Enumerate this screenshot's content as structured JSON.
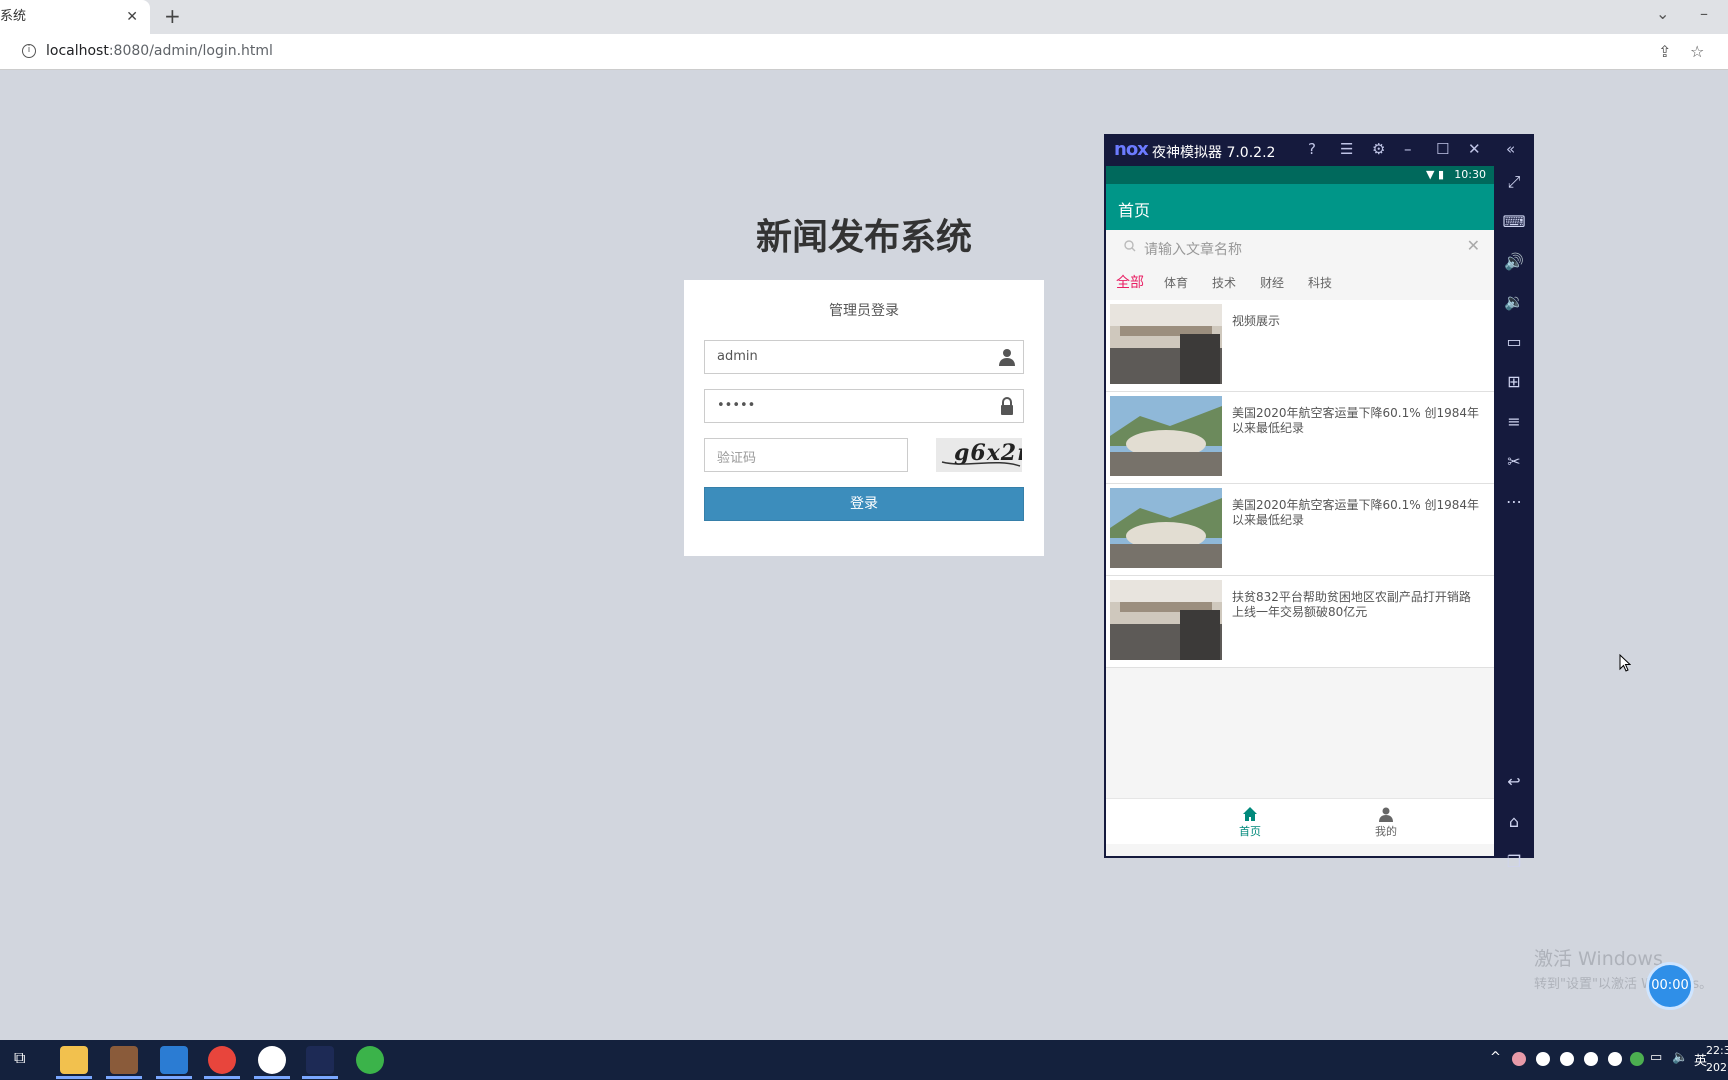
{
  "browser": {
    "tab_title": "系统",
    "tab_close": "✕",
    "new_tab": "+",
    "url_host": "localhost",
    "url_rest": ":8080/admin/login.html"
  },
  "login": {
    "system_title": "新闻发布系统",
    "heading": "管理员登录",
    "username_value": "admin",
    "password_value": "•••••",
    "captcha_placeholder": "验证码",
    "captcha_text": "g6x2n",
    "submit_label": "登录"
  },
  "nox": {
    "logo": "nox",
    "title": "夜神模拟器 7.0.2.2"
  },
  "phone": {
    "time": "10:30",
    "appbar_title": "首页",
    "search_placeholder": "请输入文章名称",
    "search_clear": "✕",
    "categories": [
      "全部",
      "体育",
      "技术",
      "财经",
      "科技"
    ],
    "articles": [
      {
        "title": "视频展示"
      },
      {
        "title": "美国2020年航空客运量下降60.1% 创1984年以来最低纪录"
      },
      {
        "title": "美国2020年航空客运量下降60.1% 创1984年以来最低纪录"
      },
      {
        "title": "扶贫832平台帮助贫困地区农副产品打开销路 上线一年交易额破80亿元"
      }
    ],
    "nav": {
      "home": "首页",
      "mine": "我的"
    }
  },
  "desktop": {
    "watermark_line1": "激活 Windows",
    "watermark_line2": "转到\"设置\"以激活 Windows。",
    "timer": "00:00"
  },
  "taskbar": {
    "ime": "英",
    "clock_time": "22:3",
    "clock_date": "202"
  },
  "colors": {
    "page_bg": "#d2d6de",
    "primary_btn": "#3c8dbc",
    "appbar": "#009688",
    "active_category": "#e91e63",
    "nox_frame": "#151a3d"
  }
}
